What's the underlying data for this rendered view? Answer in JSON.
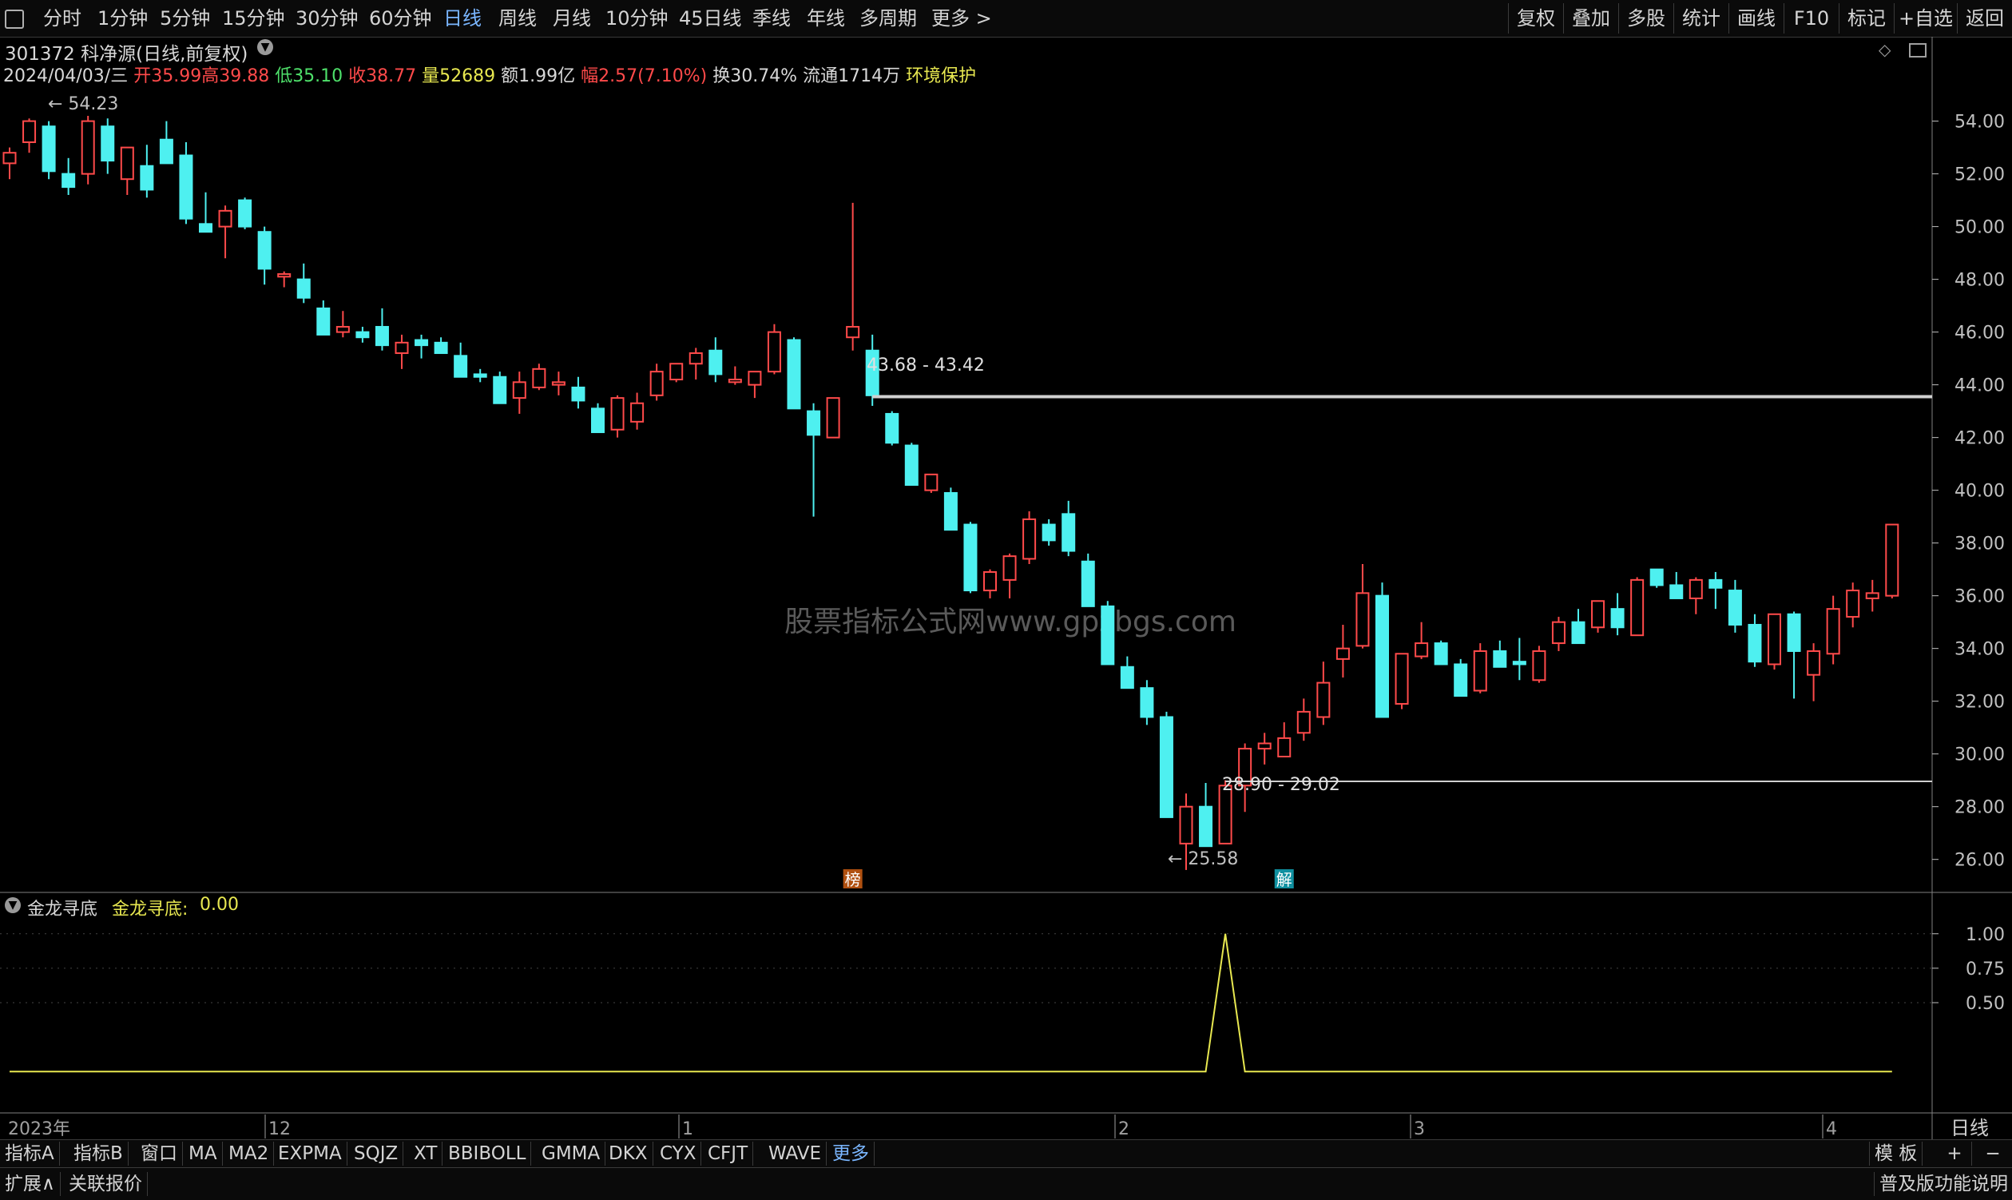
{
  "top_tabs": [
    "分时",
    "1分钟",
    "5分钟",
    "15分钟",
    "30分钟",
    "60分钟",
    "日线",
    "周线",
    "月线",
    "10分钟",
    "45日线",
    "季线",
    "年线",
    "多周期",
    "更多 >"
  ],
  "top_active": "日线",
  "right_tools": [
    "复权",
    "叠加",
    "多股",
    "统计",
    "画线",
    "F10",
    "标记",
    "+自选",
    "返回"
  ],
  "stock": {
    "title": "301372 科净源(日线,前复权)",
    "date": "2024/04/03/三",
    "open": "开35.99",
    "high": "高39.88",
    "low": "低35.10",
    "close": "收38.77",
    "volume": "量52689",
    "amount": "额1.99亿",
    "change": "幅2.57(7.10%)",
    "turnover": "换30.74%",
    "float": "流通1714万",
    "tag": "环境保护"
  },
  "watermark": "股票指标公式网www.gpzbgs.com",
  "indicator": {
    "name": "金龙寻底",
    "label": "金龙寻底:",
    "value": "0.00"
  },
  "date_axis": {
    "year": "2023年",
    "months": [
      "12",
      "1",
      "2",
      "3",
      "4"
    ]
  },
  "period_label": "日线",
  "bottom_tabs": [
    "指标A",
    "指标B",
    "窗口",
    "MA",
    "MA2",
    "EXPMA",
    "SQJZ",
    "XT",
    "BBIBOLL",
    "GMMA",
    "DKX",
    "CYX",
    "CFJT",
    "WAVE",
    "更多"
  ],
  "bottom_active": "更多",
  "template_label": "模 板",
  "zoom_plus": "+",
  "zoom_minus": "−",
  "status": {
    "expand": "扩展∧",
    "related": "关联报价",
    "help": "普及版功能说明"
  },
  "colors": {
    "up": "#ff4a4a",
    "down": "#4ef0f0",
    "line": "#e8e850",
    "axis": "#c0c0c0"
  },
  "chart_data": [
    {
      "type": "candlestick",
      "title": "301372 科净源(日线,前复权)",
      "ylim": [
        24.9,
        55.2
      ],
      "y_ticks": [
        "54.00",
        "52.00",
        "50.00",
        "48.00",
        "46.00",
        "44.00",
        "42.00",
        "40.00",
        "38.00",
        "36.00",
        "34.00",
        "32.00",
        "30.00",
        "28.00",
        "26.00"
      ],
      "annotations": [
        "54.23",
        "43.68 - 43.42",
        "28.90 - 29.02",
        "25.58"
      ],
      "markers": [
        "榜",
        "解"
      ],
      "candles": [
        [
          52.4,
          53.0,
          51.8,
          52.8
        ],
        [
          53.2,
          54.1,
          52.8,
          54.0
        ],
        [
          53.8,
          54.0,
          51.8,
          52.1
        ],
        [
          52.0,
          52.6,
          51.2,
          51.5
        ],
        [
          52.0,
          54.2,
          51.6,
          54.0
        ],
        [
          53.8,
          54.1,
          52.0,
          52.5
        ],
        [
          51.8,
          53.0,
          51.2,
          53.0
        ],
        [
          52.3,
          53.1,
          51.1,
          51.4
        ],
        [
          53.3,
          54.0,
          52.5,
          52.4
        ],
        [
          52.7,
          53.2,
          50.1,
          50.3
        ],
        [
          50.1,
          51.3,
          49.9,
          49.8
        ],
        [
          50.0,
          50.8,
          48.8,
          50.6
        ],
        [
          51.0,
          51.1,
          49.9,
          50.0
        ],
        [
          49.8,
          50.0,
          47.8,
          48.4
        ],
        [
          48.1,
          48.3,
          47.7,
          48.2
        ],
        [
          48.0,
          48.6,
          47.1,
          47.3
        ],
        [
          46.9,
          47.2,
          45.9,
          45.9
        ],
        [
          46.0,
          46.8,
          45.8,
          46.2
        ],
        [
          46.0,
          46.2,
          45.6,
          45.8
        ],
        [
          46.2,
          46.9,
          45.3,
          45.5
        ],
        [
          45.2,
          45.9,
          44.6,
          45.6
        ],
        [
          45.7,
          45.9,
          45.0,
          45.5
        ],
        [
          45.6,
          45.8,
          45.2,
          45.2
        ],
        [
          45.1,
          45.6,
          44.3,
          44.3
        ],
        [
          44.4,
          44.6,
          44.1,
          44.3
        ],
        [
          44.3,
          44.5,
          43.3,
          43.3
        ],
        [
          43.5,
          44.5,
          42.9,
          44.1
        ],
        [
          43.9,
          44.8,
          43.8,
          44.6
        ],
        [
          44.0,
          44.5,
          43.6,
          44.1
        ],
        [
          43.9,
          44.3,
          43.1,
          43.4
        ],
        [
          43.1,
          43.3,
          42.2,
          42.2
        ],
        [
          42.3,
          43.6,
          42.0,
          43.5
        ],
        [
          42.6,
          43.7,
          42.3,
          43.3
        ],
        [
          43.6,
          44.8,
          43.4,
          44.5
        ],
        [
          44.2,
          44.8,
          44.1,
          44.8
        ],
        [
          44.8,
          45.4,
          44.2,
          45.2
        ],
        [
          45.3,
          45.8,
          44.1,
          44.4
        ],
        [
          44.1,
          44.7,
          44.0,
          44.2
        ],
        [
          44.0,
          44.4,
          43.5,
          44.5
        ],
        [
          44.5,
          46.3,
          44.4,
          46.0
        ],
        [
          45.7,
          45.8,
          43.2,
          43.1
        ],
        [
          43.0,
          43.3,
          39.0,
          42.1
        ],
        [
          42.0,
          43.5,
          42.0,
          43.5
        ],
        [
          45.8,
          50.9,
          45.3,
          46.2
        ],
        [
          45.3,
          45.9,
          43.2,
          43.6
        ],
        [
          42.9,
          43.0,
          41.7,
          41.8
        ],
        [
          41.7,
          41.8,
          40.2,
          40.2
        ],
        [
          40.0,
          40.4,
          39.9,
          40.6
        ],
        [
          39.9,
          40.1,
          38.5,
          38.5
        ],
        [
          38.7,
          38.8,
          36.1,
          36.2
        ],
        [
          36.2,
          37.0,
          35.9,
          36.9
        ],
        [
          36.6,
          37.6,
          35.9,
          37.5
        ],
        [
          37.4,
          39.2,
          37.2,
          38.9
        ],
        [
          38.7,
          38.9,
          37.9,
          38.1
        ],
        [
          39.1,
          39.6,
          37.5,
          37.7
        ],
        [
          37.3,
          37.6,
          35.6,
          35.6
        ],
        [
          35.6,
          35.8,
          33.6,
          33.4
        ],
        [
          33.3,
          33.7,
          33.1,
          32.5
        ],
        [
          32.5,
          32.8,
          31.1,
          31.4
        ],
        [
          31.4,
          31.6,
          27.7,
          27.6
        ],
        [
          26.6,
          28.5,
          25.6,
          28.0
        ],
        [
          28.0,
          28.9,
          26.7,
          26.5
        ],
        [
          26.6,
          29.0,
          26.7,
          28.8
        ],
        [
          28.8,
          30.4,
          27.8,
          30.2
        ],
        [
          30.2,
          30.8,
          29.6,
          30.4
        ],
        [
          29.9,
          31.2,
          29.9,
          30.6
        ],
        [
          30.8,
          32.1,
          30.5,
          31.6
        ],
        [
          31.4,
          33.5,
          31.1,
          32.7
        ],
        [
          33.6,
          34.9,
          32.9,
          34.0
        ],
        [
          34.1,
          37.2,
          34.0,
          36.1
        ],
        [
          36.0,
          36.5,
          32.1,
          31.4
        ],
        [
          31.9,
          33.6,
          31.7,
          33.8
        ],
        [
          33.7,
          35.0,
          33.6,
          34.2
        ],
        [
          34.2,
          34.3,
          33.4,
          33.4
        ],
        [
          33.4,
          33.6,
          32.2,
          32.2
        ],
        [
          32.4,
          34.2,
          32.3,
          33.9
        ],
        [
          33.9,
          34.3,
          33.5,
          33.3
        ],
        [
          33.5,
          34.4,
          32.8,
          33.4
        ],
        [
          32.8,
          34.1,
          32.7,
          33.9
        ],
        [
          34.2,
          35.2,
          33.9,
          35.0
        ],
        [
          35.0,
          35.5,
          34.2,
          34.2
        ],
        [
          34.8,
          35.3,
          34.6,
          35.8
        ],
        [
          35.5,
          36.1,
          34.5,
          34.8
        ],
        [
          34.5,
          36.7,
          34.5,
          36.6
        ],
        [
          37.0,
          36.9,
          36.3,
          36.4
        ],
        [
          36.4,
          36.9,
          36.0,
          35.9
        ],
        [
          35.9,
          36.7,
          35.3,
          36.6
        ],
        [
          36.6,
          36.9,
          35.5,
          36.3
        ],
        [
          36.2,
          36.6,
          34.6,
          34.9
        ],
        [
          34.9,
          35.3,
          33.3,
          33.5
        ],
        [
          33.4,
          35.3,
          33.2,
          35.3
        ],
        [
          35.3,
          35.4,
          32.1,
          33.9
        ],
        [
          33.0,
          34.2,
          32.0,
          33.9
        ],
        [
          33.8,
          36.0,
          33.4,
          35.5
        ],
        [
          35.2,
          36.5,
          34.8,
          36.2
        ],
        [
          35.9,
          36.6,
          35.4,
          36.1
        ],
        [
          36.0,
          36.9,
          35.9,
          38.7
        ]
      ]
    },
    {
      "type": "line",
      "title": "金龙寻底",
      "ylim": [
        -0.3,
        1.3
      ],
      "y_ticks": [
        "1.00",
        "0.75",
        "0.50"
      ],
      "values": [
        0,
        0,
        0,
        0,
        0,
        0,
        0,
        0,
        0,
        0,
        0,
        0,
        0,
        0,
        0,
        0,
        0,
        0,
        0,
        0,
        0,
        0,
        0,
        0,
        0,
        0,
        0,
        0,
        0,
        0,
        0,
        0,
        0,
        0,
        0,
        0,
        0,
        0,
        0,
        0,
        0,
        0,
        0,
        0,
        0,
        0,
        0,
        0,
        0,
        0,
        0,
        0,
        0,
        0,
        0,
        0,
        0,
        0,
        0,
        0,
        0,
        0,
        1,
        0,
        0,
        0,
        0,
        0,
        0,
        0,
        0,
        0,
        0,
        0,
        0,
        0,
        0,
        0,
        0,
        0,
        0,
        0,
        0,
        0,
        0,
        0,
        0,
        0,
        0,
        0,
        0,
        0,
        0,
        0,
        0,
        0,
        0
      ]
    }
  ]
}
